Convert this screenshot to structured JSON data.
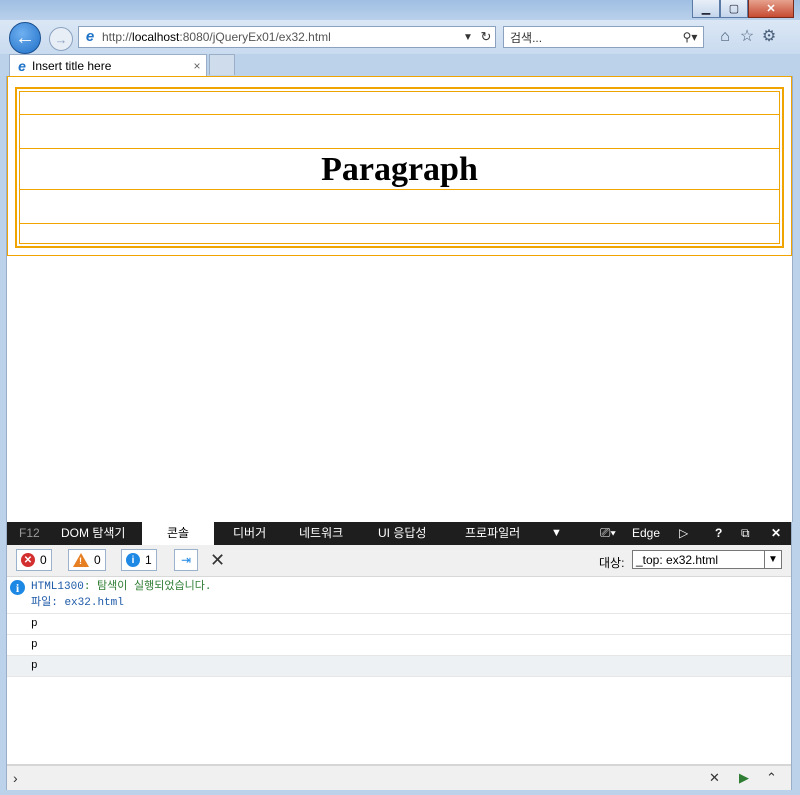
{
  "browser": {
    "address_url": "http://localhost:8080/jQueryEx01/ex32.html",
    "address_host": "localhost",
    "search_placeholder": "검색...",
    "tab_title": "Insert title here",
    "tab_close": "×"
  },
  "page": {
    "paragraph_text": "Paragraph"
  },
  "devtools": {
    "tabs": [
      "F12",
      "DOM 탐색기",
      "콘솔",
      "디버거",
      "네트워크",
      "UI 응답성",
      "프로파일러"
    ],
    "active_tab": "콘솔",
    "mode": "Edge",
    "counts": {
      "errors": "0",
      "warnings": "0",
      "info": "1"
    },
    "target_label": "대상:",
    "target_value": "_top: ex32.html",
    "logs": {
      "code": "HTML1300",
      "message": ": 탐색이 실행되었습니다.",
      "file": "파일: ex32.html",
      "lines": [
        "p",
        "p",
        "p"
      ]
    }
  },
  "colors": {
    "frame_border": "#f0a400",
    "accent_blue": "#1e73c8"
  }
}
